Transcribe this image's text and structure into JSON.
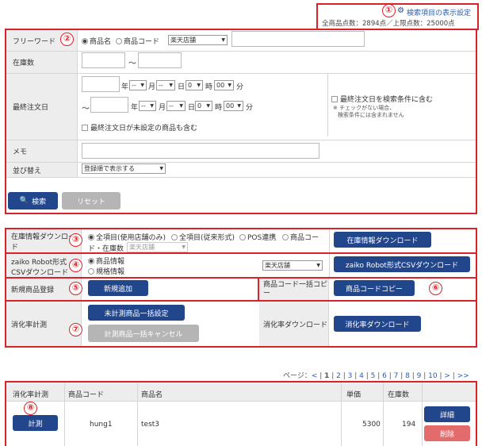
{
  "top": {
    "settings_link": "検索項目の表示設定",
    "counts": "全商品点数：2894点／上限点数：25000点"
  },
  "markers": [
    "①",
    "②",
    "③",
    "④",
    "⑤",
    "⑥",
    "⑦",
    "⑧"
  ],
  "search": {
    "freeword_label": "フリーワード",
    "radio_name": "商品名",
    "radio_code": "商品コード",
    "store_select": "楽天店舗",
    "stock_label": "在庫数",
    "tilde": "〜",
    "last_order_label": "最終注文日",
    "year": "年",
    "month": "月",
    "day": "日",
    "hour": "時",
    "minute": "分",
    "dash": "--",
    "zero": "0",
    "zerozero": "00",
    "include_unset": "最終注文日が未設定の商品も含む",
    "include_in_condition": "最終注文日を検索条件に含む",
    "note1": "※ チェックがない場合、",
    "note2": "検索条件には含まれません",
    "memo_label": "メモ",
    "sort_label": "並び替え",
    "sort_select": "登録順で表示する",
    "search_button": "検索",
    "reset_button": "リセット"
  },
  "tools": {
    "stock_dl_label": "在庫情報ダウンロード",
    "opt_all_store": "全項目(使用店舗のみ)",
    "opt_all_legacy": "全項目(従来形式)",
    "opt_pos": "POS連携",
    "opt_code_stock_1": "商品コー",
    "opt_code_stock_2": "ド・在庫数",
    "store_select_disabled": "楽天店舗",
    "stock_dl_button": "在庫情報ダウンロード",
    "zaiko_label_1": "zaiko Robot形式",
    "zaiko_label_2": "CSVダウンロード",
    "opt_product_info": "商品情報",
    "opt_spec_info": "規格情報",
    "zaiko_store_select": "楽天店舗",
    "zaiko_button": "zaiko Robot形式CSVダウンロード",
    "new_label": "新規商品登録",
    "new_button": "新規追加",
    "copy_label": "商品コード一括コピー",
    "copy_button": "商品コードコピー",
    "consume_label": "消化率計測",
    "consume_set_button": "未計測商品一括設定",
    "consume_cancel_button": "計測商品一括キャンセル",
    "consume_dl_label": "消化率ダウンロード",
    "consume_dl_button": "消化率ダウンロード"
  },
  "pager": {
    "prefix": "ページ：",
    "prev": "<",
    "current": "1",
    "pages": [
      "2",
      "3",
      "4",
      "5",
      "6",
      "7",
      "8",
      "9",
      "10"
    ],
    "next": ">",
    "last": ">>"
  },
  "table": {
    "headers": [
      "消化率計測",
      "商品コード",
      "商品名",
      "単価",
      "在庫数"
    ],
    "rows": [
      {
        "measure_button": "計測",
        "code": "hung1",
        "name": "test3",
        "price": "5300",
        "stock": "194",
        "detail_button": "詳細",
        "delete_button": "削除"
      }
    ]
  },
  "colors": {
    "accent": "#21468c",
    "marker": "#d9232a",
    "label_bg": "#ededed"
  }
}
